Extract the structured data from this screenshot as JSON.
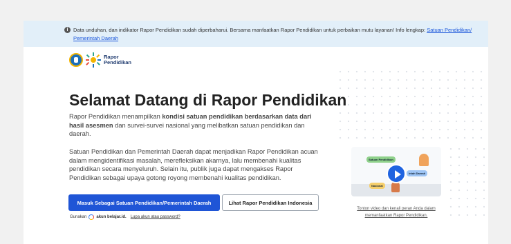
{
  "notice": {
    "text": "Data unduhan, dan indikator Rapor Pendidikan sudah diperbaharui. Bersama manfaatkan Rapor Pendidikan untuk perbaikan mutu layanan! Info lengkap:",
    "link": "Satuan Pendidikan/ Pemerintah Daerah",
    "icon": "info-icon"
  },
  "logo": {
    "line1": "Rapor",
    "line2": "Pendidikan"
  },
  "hero": {
    "title": "Selamat Datang di Rapor Pendidikan",
    "para1_a": "Rapor Pendidikan menampilkan ",
    "para1_b": "kondisi satuan pendidikan berdasarkan data dari hasil asesmen",
    "para1_c": " dan survei-survei nasional yang melibatkan satuan pendidikan dan daerah.",
    "para2": "Satuan Pendidikan dan Pemerintah Daerah dapat menjadikan Rapor Pendidikan acuan dalam mengidentifikasi masalah, merefleksikan akarnya, lalu membenahi kualitas pendidikan secara menyeluruh. Selain itu, publik juga dapat mengakses Rapor Pendidikan sebagai upaya gotong royong membenahi kualitas pendidikan."
  },
  "buttons": {
    "primary": "Masuk Sebagai Satuan Pendidikan/Pemerintah Daerah",
    "secondary": "Lihat Rapor Pendidikan Indonesia"
  },
  "login": {
    "prefix": "Gunakan",
    "account": "akun belajar.id.",
    "forgot": "Lupa akun atau password?"
  },
  "video": {
    "chip1": "Satuan Pendidikan",
    "chip2": "intah Daerah",
    "chip3": "Nasional",
    "caption": "Tonton video dan kenali peran Anda dalam memanfaatkan Rapor Pendidikan."
  },
  "colors": {
    "primary": "#1f55d6",
    "notice_bg": "#e2eff9",
    "link": "#1a56db"
  }
}
